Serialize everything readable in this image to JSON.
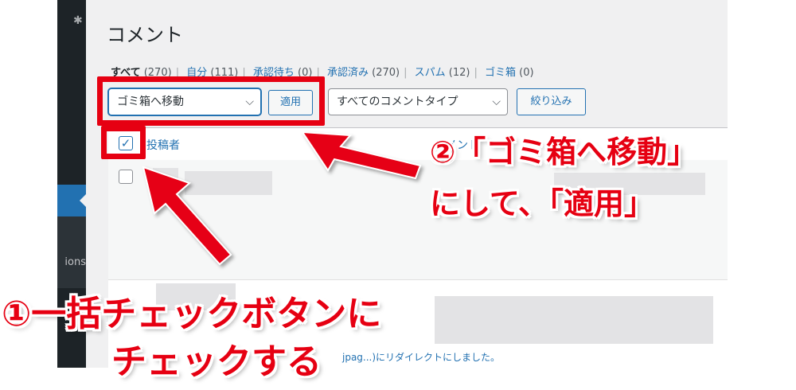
{
  "sidebar": {
    "menu_label_fragment": "ions",
    "top_glyph": "✱"
  },
  "page": {
    "title": "コメント"
  },
  "filters": [
    {
      "label": "すべて",
      "count": "(270)",
      "current": true
    },
    {
      "label": "自分",
      "count": "(111)",
      "current": false
    },
    {
      "label": "承認待ち",
      "count": "(0)",
      "current": false
    },
    {
      "label": "承認済み",
      "count": "(270)",
      "current": false
    },
    {
      "label": "スパム",
      "count": "(12)",
      "current": false
    },
    {
      "label": "ゴミ箱",
      "count": "(0)",
      "current": false
    }
  ],
  "toolbar": {
    "bulk_action_selected": "ゴミ箱へ移動",
    "apply_label": "適用",
    "comment_type_selected": "すべてのコメントタイプ",
    "filter_label": "絞り込み"
  },
  "table": {
    "columns": [
      "投稿者",
      "コメント"
    ],
    "header_checkbox_checked": true,
    "footer_fragment": "jpag...)にリダイレクトにしました。"
  },
  "annotations": {
    "step2_line1": "②「ゴミ箱へ移動」",
    "step2_line2": "にして、「適用」",
    "step1_line1": "①一括チェックボタンに",
    "step1_line2": "チェックする"
  },
  "colors": {
    "annotation_red": "#e60012",
    "wp_blue": "#2271b1",
    "sidebar_dark": "#1d2327",
    "panel_bg": "#f0f0f1"
  }
}
